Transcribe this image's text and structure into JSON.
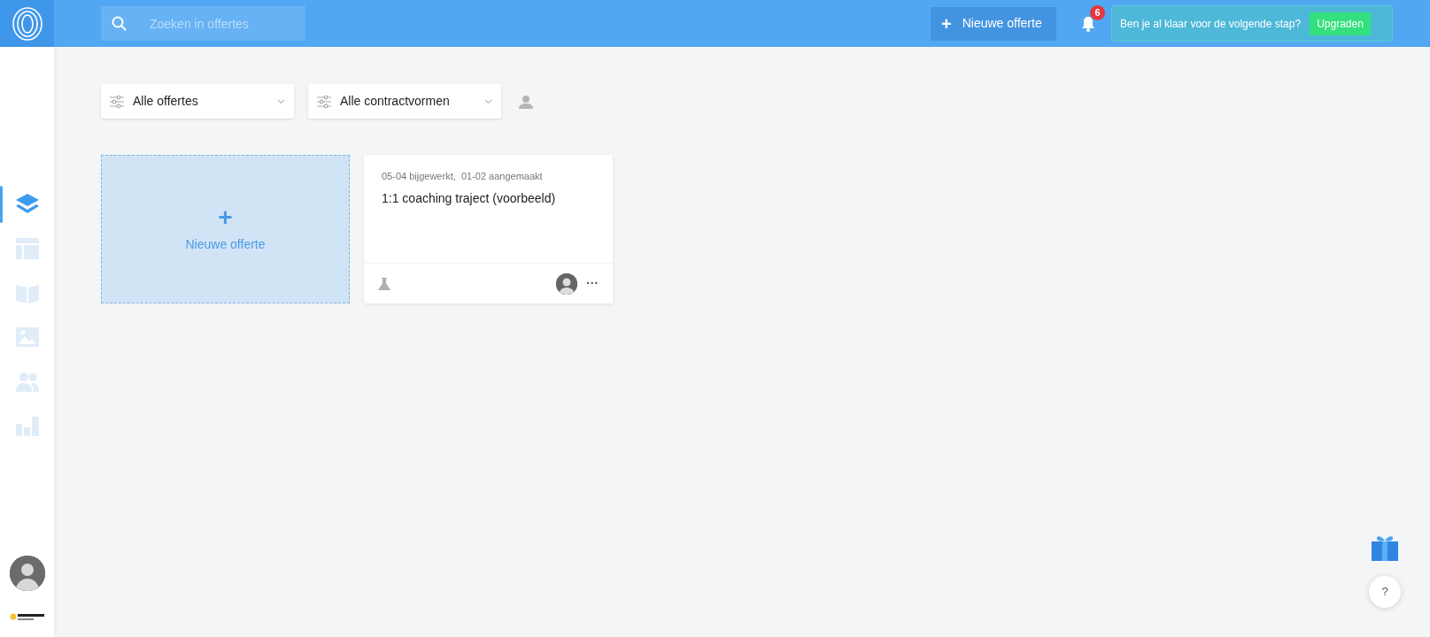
{
  "header": {
    "search": {
      "placeholder": "Zoeken in offertes"
    },
    "new_button": {
      "icon": "+",
      "label": "Nieuwe offerte"
    },
    "notifications": {
      "count": "6"
    },
    "upgrade": {
      "text": "Ben je al klaar voor de volgende stap?",
      "button": "Upgraden"
    }
  },
  "sidebar": {
    "items": [
      {
        "kind": "layers",
        "selected": true
      },
      {
        "kind": "layout",
        "selected": false
      },
      {
        "kind": "book",
        "selected": false
      },
      {
        "kind": "image",
        "selected": false
      },
      {
        "kind": "users",
        "selected": false
      },
      {
        "kind": "chart",
        "selected": false
      }
    ]
  },
  "filters": [
    {
      "label": "Alle offertes"
    },
    {
      "label": "Alle contractvormen"
    }
  ],
  "new_card": {
    "icon": "+",
    "label": "Nieuwe offerte"
  },
  "offers": [
    {
      "meta": "05-04 bijgewerkt,  01-02 aangemaakt",
      "title": "1:1 coaching traject (voorbeeld)",
      "more": "···"
    }
  ],
  "help": {
    "label": "?"
  }
}
